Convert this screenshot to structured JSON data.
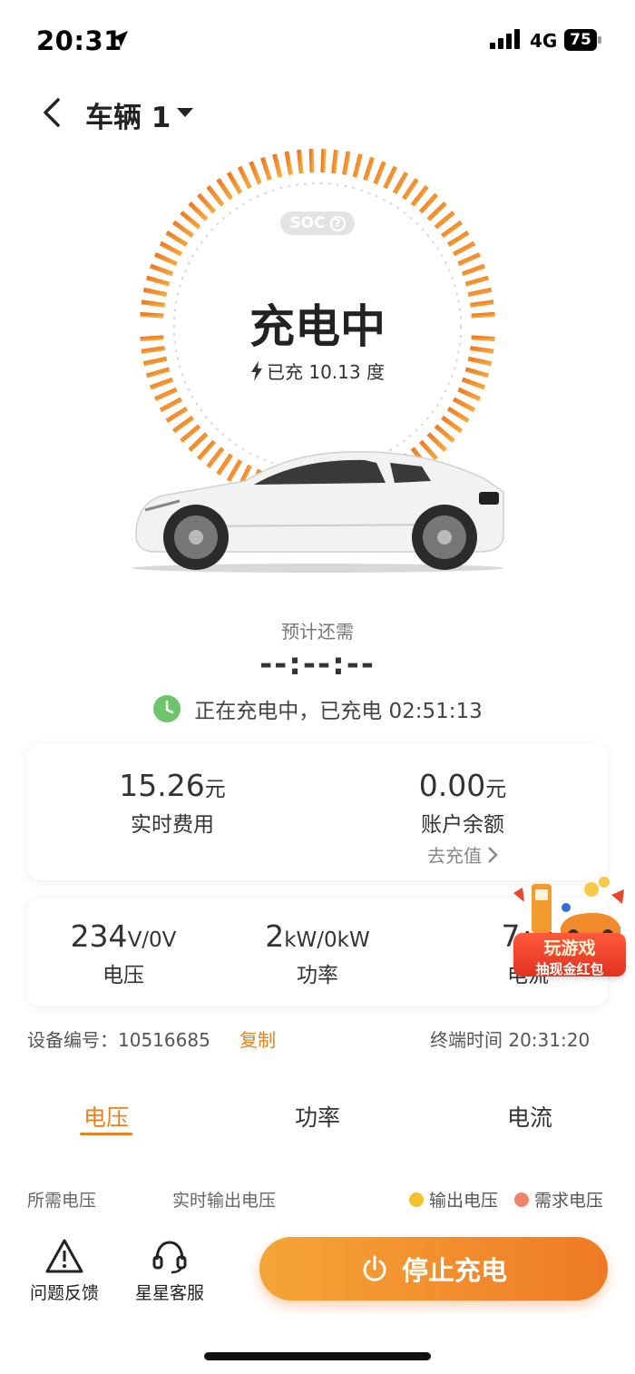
{
  "status_bar": {
    "time": "20:31",
    "network": "4G",
    "battery": "75"
  },
  "header": {
    "title": "车辆 1"
  },
  "gauge": {
    "soc_label": "SOC",
    "help_glyph": "?",
    "status": "充电中",
    "charged": "已充 10.13 度"
  },
  "remaining": {
    "label": "预计还需",
    "value": "--:--:--",
    "elapsed_text": "正在充电中，已充电 02:51:13"
  },
  "fee_card": {
    "realtime_fee": {
      "value": "15.26",
      "unit": "元",
      "label": "实时费用"
    },
    "balance": {
      "value": "0.00",
      "unit": "元",
      "label": "账户余额",
      "action": "去充值"
    }
  },
  "metrics_card": {
    "voltage": {
      "value": "234",
      "unit": "V/0V",
      "label": "电压"
    },
    "power": {
      "value": "2",
      "unit": "kW/0kW",
      "label": "功率"
    },
    "current": {
      "value": "7",
      "unit": "A/0",
      "label": "电流"
    }
  },
  "device": {
    "label": "设备编号：10516685",
    "copy": "复制",
    "terminal_time": "终端时间 20:31:20"
  },
  "tabs": [
    {
      "label": "电压"
    },
    {
      "label": "功率"
    },
    {
      "label": "电流"
    }
  ],
  "chart_legend": {
    "required": "所需电压",
    "realtime": "实时输出电压",
    "output": "输出电压",
    "demand": "需求电压",
    "output_color": "#f2c12e",
    "demand_color": "#f3826a"
  },
  "bottom": {
    "feedback": "问题反馈",
    "service": "星星客服",
    "stop": "停止充电"
  },
  "promo": {
    "title": "玩游戏",
    "subtitle": "抽现金红包"
  },
  "colors": {
    "accent": "#e8821d",
    "gauge_start": "#ef7a25",
    "gauge_end": "#f6a93a"
  }
}
